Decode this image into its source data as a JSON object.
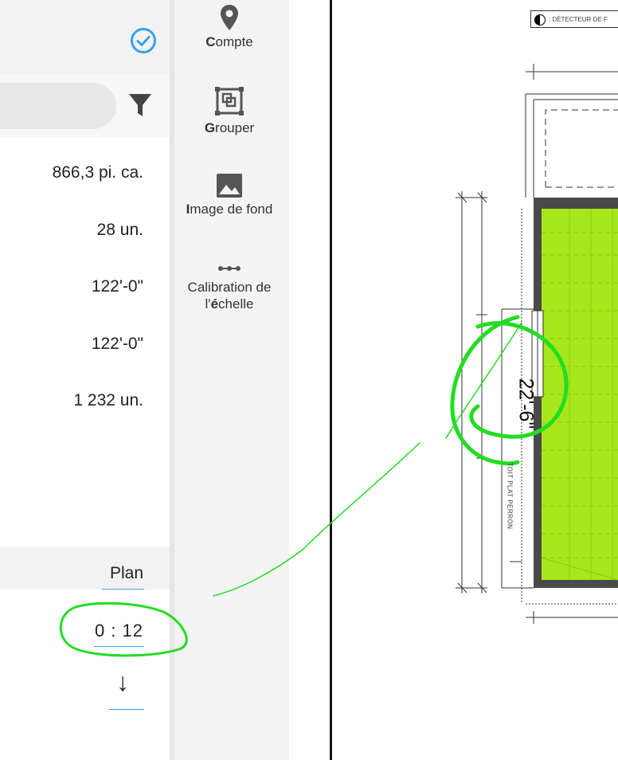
{
  "left_panel": {
    "metrics": [
      "866,3 pi. ca.",
      "28 un.",
      "122'-0\"",
      "122'-0\"",
      "1 232 un."
    ],
    "plan_label": "Plan",
    "scale_value": "0 : 12",
    "accent_color": "#3aa0e8"
  },
  "toolbar": {
    "compte": {
      "first": "C",
      "rest": "ompte"
    },
    "grouper": {
      "first": "G",
      "rest": "rouper"
    },
    "image": {
      "first": "I",
      "rest": "mage de fond"
    },
    "calibration": {
      "line1": "Calibration de",
      "line2_pre": "l'",
      "line2_bold": "é",
      "line2_post": "chelle"
    }
  },
  "drawing": {
    "legend_text": ": DÉTECTEUR DE F",
    "dimension": "22'-6\"",
    "roof_text": "TOIT PLAT PERRON",
    "highlight_color": "#a8e61c",
    "annotation_color": "#22dd22"
  }
}
